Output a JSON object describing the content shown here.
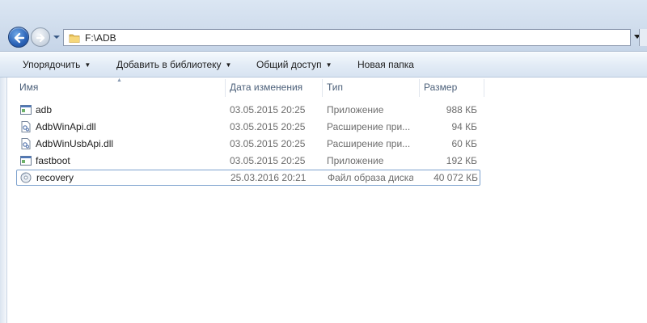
{
  "address": {
    "path": "F:\\ADB"
  },
  "toolbar": {
    "organize": "Упорядочить",
    "add_to_library": "Добавить в библиотеку",
    "share": "Общий доступ",
    "new_folder": "Новая папка"
  },
  "columns": {
    "name": "Имя",
    "date": "Дата изменения",
    "type": "Тип",
    "size": "Размер"
  },
  "files": [
    {
      "name": "adb",
      "date": "03.05.2015 20:25",
      "type": "Приложение",
      "size": "988 КБ",
      "icon": "application-icon"
    },
    {
      "name": "AdbWinApi.dll",
      "date": "03.05.2015 20:25",
      "type": "Расширение при...",
      "size": "94 КБ",
      "icon": "dll-icon"
    },
    {
      "name": "AdbWinUsbApi.dll",
      "date": "03.05.2015 20:25",
      "type": "Расширение при...",
      "size": "60 КБ",
      "icon": "dll-icon"
    },
    {
      "name": "fastboot",
      "date": "03.05.2015 20:25",
      "type": "Приложение",
      "size": "192 КБ",
      "icon": "application-icon"
    },
    {
      "name": "recovery",
      "date": "25.03.2016 20:21",
      "type": "Файл образа диска",
      "size": "40 072 КБ",
      "icon": "disk-image-icon",
      "selected": true
    }
  ],
  "colors": {
    "header_text": "#4c607a",
    "selection_border": "#7da2ce",
    "back_button": "#2a62b6"
  }
}
